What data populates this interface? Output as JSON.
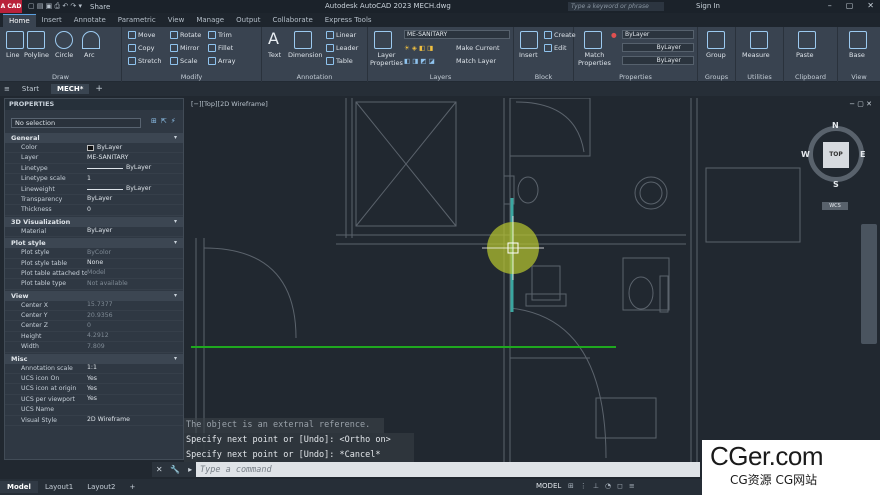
{
  "titlebar": {
    "app_badge": "A CAD",
    "share_label": "Share",
    "window_title": "Autodesk AutoCAD 2023    MECH.dwg",
    "search_placeholder": "Type a keyword or phrase",
    "signin_label": "Sign In"
  },
  "ribbon_tabs": [
    "Home",
    "Insert",
    "Annotate",
    "Parametric",
    "View",
    "Manage",
    "Output",
    "Collaborate",
    "Express Tools"
  ],
  "ribbon": {
    "draw": {
      "title": "Draw",
      "items": [
        "Line",
        "Polyline",
        "Circle",
        "Arc"
      ]
    },
    "modify": {
      "title": "Modify",
      "items": [
        "Move",
        "Rotate",
        "Trim",
        "Copy",
        "Mirror",
        "Fillet",
        "Stretch",
        "Scale",
        "Array"
      ]
    },
    "annotation": {
      "title": "Annotation",
      "items": [
        "Text",
        "Dimension",
        "Linear",
        "Leader",
        "Table"
      ]
    },
    "layers": {
      "title": "Layers",
      "layer_properties": "Layer Properties",
      "current_layer": "ME-SANITARY",
      "make_current": "Make Current",
      "match_layer": "Match Layer"
    },
    "block": {
      "title": "Block",
      "items": [
        "Insert",
        "Create",
        "Edit"
      ]
    },
    "properties": {
      "title": "Properties",
      "match_properties": "Match Properties",
      "color": "ByLayer",
      "linetype": "ByLayer",
      "lineweight": "ByLayer"
    },
    "groups": {
      "title": "Groups",
      "label": "Group"
    },
    "utilities": {
      "title": "Utilities",
      "label": "Measure"
    },
    "clipboard": {
      "title": "Clipboard",
      "label": "Paste"
    },
    "view": {
      "title": "View",
      "label": "Base"
    }
  },
  "doc_tabs": [
    "Start",
    "MECH*"
  ],
  "properties_panel": {
    "title": "PROPERTIES",
    "selection": "No selection",
    "sections": [
      {
        "name": "General",
        "rows": [
          {
            "k": "Color",
            "v": "ByLayer"
          },
          {
            "k": "Layer",
            "v": "ME-SANITARY"
          },
          {
            "k": "Linetype",
            "v": "ByLayer"
          },
          {
            "k": "Linetype scale",
            "v": "1"
          },
          {
            "k": "Lineweight",
            "v": "ByLayer"
          },
          {
            "k": "Transparency",
            "v": "ByLayer"
          },
          {
            "k": "Thickness",
            "v": "0"
          }
        ]
      },
      {
        "name": "3D Visualization",
        "rows": [
          {
            "k": "Material",
            "v": "ByLayer"
          }
        ]
      },
      {
        "name": "Plot style",
        "rows": [
          {
            "k": "Plot style",
            "v": "ByColor"
          },
          {
            "k": "Plot style table",
            "v": "None"
          },
          {
            "k": "Plot table attached to",
            "v": "Model"
          },
          {
            "k": "Plot table type",
            "v": "Not available"
          }
        ]
      },
      {
        "name": "View",
        "rows": [
          {
            "k": "Center X",
            "v": "15.7377"
          },
          {
            "k": "Center Y",
            "v": "20.9356"
          },
          {
            "k": "Center Z",
            "v": "0"
          },
          {
            "k": "Height",
            "v": "4.2912"
          },
          {
            "k": "Width",
            "v": "7.809"
          }
        ]
      },
      {
        "name": "Misc",
        "rows": [
          {
            "k": "Annotation scale",
            "v": "1:1"
          },
          {
            "k": "UCS icon On",
            "v": "Yes"
          },
          {
            "k": "UCS icon at origin",
            "v": "Yes"
          },
          {
            "k": "UCS per viewport",
            "v": "Yes"
          },
          {
            "k": "UCS Name",
            "v": ""
          },
          {
            "k": "Visual Style",
            "v": "2D Wireframe"
          }
        ]
      }
    ]
  },
  "viewport": {
    "label": "[−][Top][2D Wireframe]"
  },
  "navcube": {
    "n": "N",
    "s": "S",
    "e": "E",
    "w": "W",
    "top": "TOP",
    "wcs": "WCS"
  },
  "command": {
    "history": [
      "The object is an external reference.",
      "Specify next point or [Undo]:  <Ortho on>",
      "Specify next point or [Undo]: *Cancel*"
    ],
    "placeholder": "Type a command"
  },
  "status": {
    "layouts": [
      "Model",
      "Layout1",
      "Layout2"
    ],
    "space": "MODEL"
  },
  "watermark": {
    "line1": "CGer.com",
    "line2": "CG资源  CG网站"
  }
}
